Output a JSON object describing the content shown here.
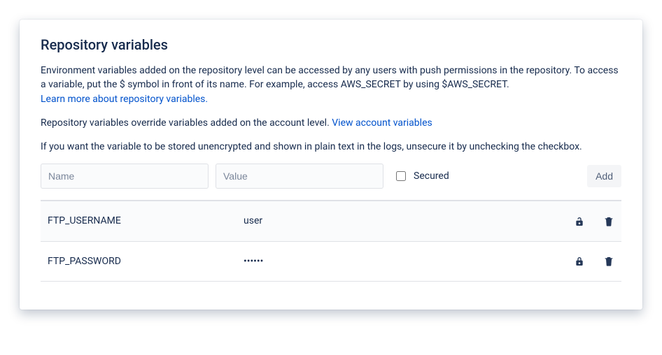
{
  "title": "Repository variables",
  "description_1": "Environment variables added on the repository level can be accessed by any users with push permissions in the repository. To access a variable, put the $ symbol in front of its name. For example, access AWS_SECRET by using $AWS_SECRET.",
  "learn_more_link": "Learn more about repository variables.",
  "override_text_pre": "Repository variables override variables added on the account level. ",
  "view_account_link": "View account variables",
  "unsecure_note": "If you want the variable to be stored unencrypted and shown in plain text in the logs, unsecure it by unchecking the checkbox.",
  "form": {
    "name_placeholder": "Name",
    "value_placeholder": "Value",
    "secured_label": "Secured",
    "add_label": "Add"
  },
  "variables": [
    {
      "name": "FTP_USERNAME",
      "value": "user",
      "secured": false
    },
    {
      "name": "FTP_PASSWORD",
      "value": "••••••",
      "secured": true
    }
  ]
}
